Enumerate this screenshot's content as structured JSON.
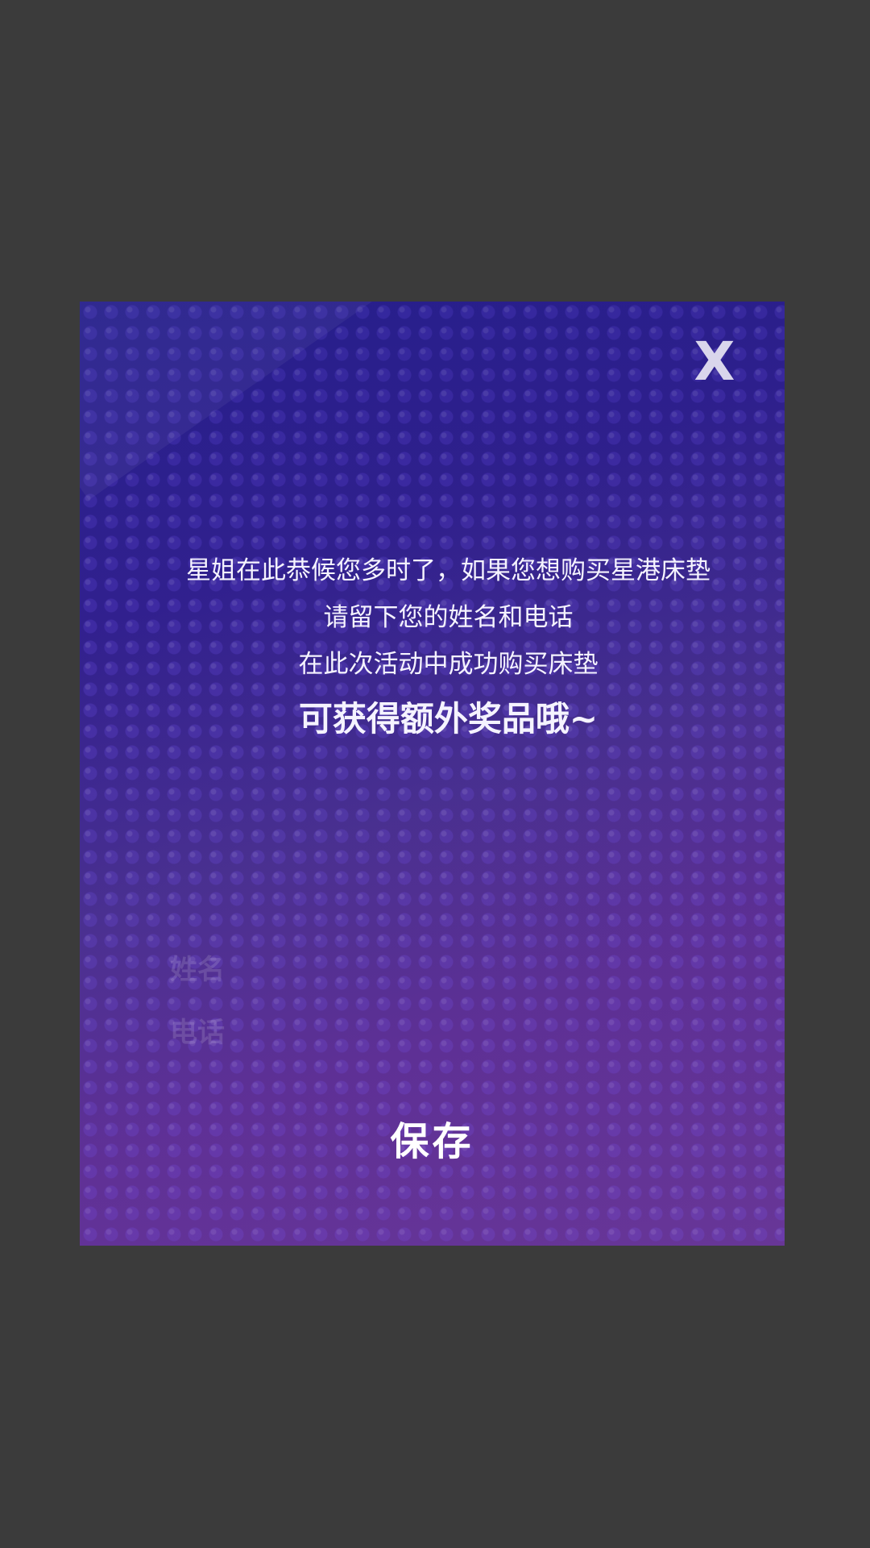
{
  "dialog": {
    "close_label": "X",
    "message_lines": [
      "星姐在此恭候您多时了，如果您想购买星港床垫",
      "请留下您的姓名和电话",
      "在此次活动中成功购买床垫"
    ],
    "highlight": "可获得额外奖品哦~",
    "fields": {
      "name_label": "姓名",
      "name_value": "",
      "phone_label": "电话",
      "phone_value": ""
    },
    "save_label": "保存"
  }
}
